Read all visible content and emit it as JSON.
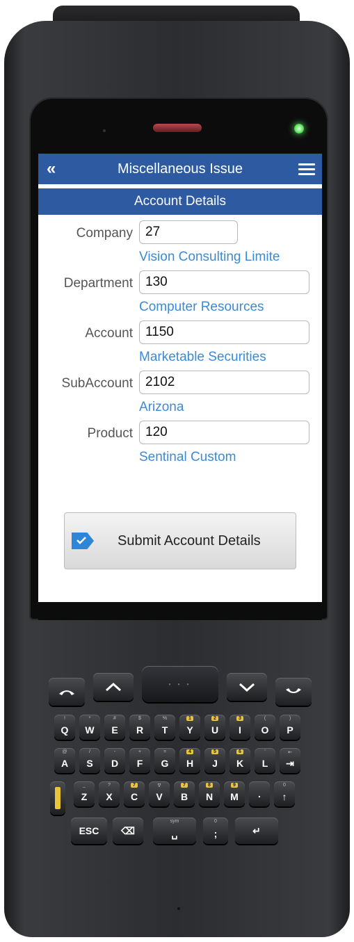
{
  "app": {
    "title": "Miscellaneous Issue",
    "section": "Account Details"
  },
  "fields": [
    {
      "label": "Company",
      "value": "27",
      "description": "Vision Consulting Limite"
    },
    {
      "label": "Department",
      "value": "130",
      "description": "Computer Resources"
    },
    {
      "label": "Account",
      "value": "1150",
      "description": "Marketable Securities"
    },
    {
      "label": "SubAccount",
      "value": "2102",
      "description": "Arizona"
    },
    {
      "label": "Product",
      "value": "120",
      "description": "Sentinal Custom"
    }
  ],
  "submit": {
    "label": "Submit Account Details"
  },
  "keypad": {
    "row1": [
      {
        "main": "Q",
        "sub": "!"
      },
      {
        "main": "W",
        "sub": "*"
      },
      {
        "main": "E",
        "sub": "#"
      },
      {
        "main": "R",
        "sub": "$"
      },
      {
        "main": "T",
        "sub": "%"
      },
      {
        "main": "Y",
        "sub": "1"
      },
      {
        "main": "U",
        "sub": "2"
      },
      {
        "main": "I",
        "sub": "3"
      },
      {
        "main": "O",
        "sub": "("
      },
      {
        "main": "P",
        "sub": ")"
      }
    ],
    "row2": [
      {
        "main": "A",
        "sub": "@"
      },
      {
        "main": "S",
        "sub": "/"
      },
      {
        "main": "D",
        "sub": "-"
      },
      {
        "main": "F",
        "sub": "+"
      },
      {
        "main": "G",
        "sub": "="
      },
      {
        "main": "H",
        "sub": "4"
      },
      {
        "main": "J",
        "sub": "5"
      },
      {
        "main": "K",
        "sub": "6"
      },
      {
        "main": "L",
        "sub": "'"
      },
      {
        "main": "⇥",
        "sub": "⇤"
      }
    ],
    "row3": [
      {
        "main": "Z",
        "sub": "_"
      },
      {
        "main": "X",
        "sub": "?"
      },
      {
        "main": "C",
        "sub": "7"
      },
      {
        "main": "V",
        "sub": "∇"
      },
      {
        "main": "B",
        "sub": "7"
      },
      {
        "main": "N",
        "sub": "8"
      },
      {
        "main": "M",
        "sub": "9"
      },
      {
        "main": ".",
        "sub": ""
      },
      {
        "main": "↑",
        "sub": "0"
      }
    ],
    "row4": [
      {
        "main": "ESC",
        "sub": ""
      },
      {
        "main": "⌫",
        "sub": ""
      },
      {
        "main": "␣",
        "sub": "sym"
      },
      {
        "main": ";",
        "sub": "0"
      },
      {
        "main": "↵",
        "sub": ""
      }
    ]
  }
}
